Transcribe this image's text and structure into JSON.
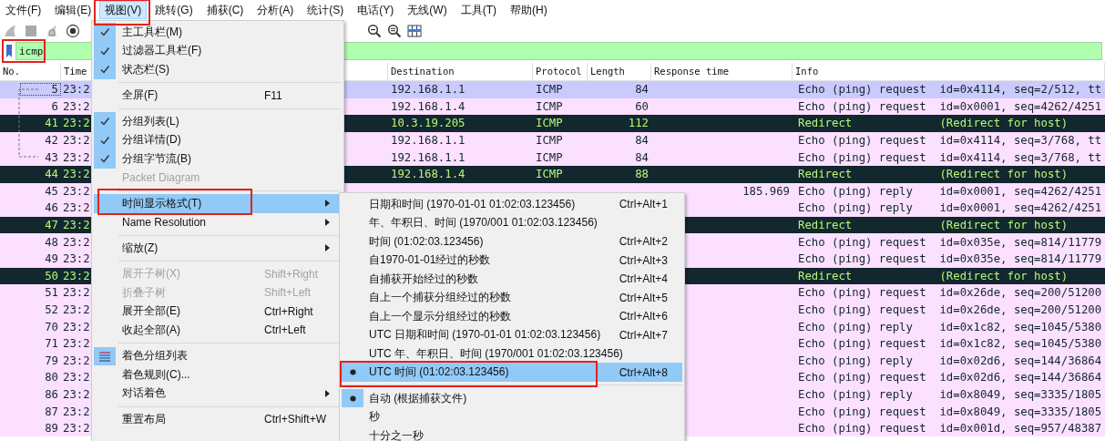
{
  "menubar": [
    {
      "label": "文件(F)",
      "selected": false,
      "annotated": false
    },
    {
      "label": "编辑(E)",
      "selected": false,
      "annotated": false
    },
    {
      "label": "视图(V)",
      "selected": true,
      "annotated": true
    },
    {
      "label": "跳转(G)",
      "selected": false,
      "annotated": false
    },
    {
      "label": "捕获(C)",
      "selected": false,
      "annotated": false
    },
    {
      "label": "分析(A)",
      "selected": false,
      "annotated": false
    },
    {
      "label": "统计(S)",
      "selected": false,
      "annotated": false
    },
    {
      "label": "电话(Y)",
      "selected": false,
      "annotated": false
    },
    {
      "label": "无线(W)",
      "selected": false,
      "annotated": false
    },
    {
      "label": "工具(T)",
      "selected": false,
      "annotated": false
    },
    {
      "label": "帮助(H)",
      "selected": false,
      "annotated": false
    }
  ],
  "filter": {
    "value": "icmp",
    "annotated": true
  },
  "table": {
    "columns": [
      {
        "label": "No."
      },
      {
        "label": "Time"
      },
      {
        "label": "Destination"
      },
      {
        "label": "Protocol"
      },
      {
        "label": "Length"
      },
      {
        "label": "Response time"
      },
      {
        "label": "Info"
      }
    ],
    "rows": [
      {
        "no": "5",
        "time": "23:2",
        "destination": "192.168.1.1",
        "protocol": "ICMP",
        "length": "84",
        "info": "Echo (ping) request  id=0x4114, seq=2/512, tt",
        "kind": "echo",
        "selected": true
      },
      {
        "no": "6",
        "time": "23:2",
        "destination": "192.168.1.4",
        "protocol": "ICMP",
        "length": "60",
        "info": "Echo (ping) request  id=0x0001, seq=4262/4251",
        "kind": "echo",
        "selected": false
      },
      {
        "no": "41",
        "time": "23:2",
        "destination": "10.3.19.205",
        "protocol": "ICMP",
        "length": "112",
        "info": "Redirect             (Redirect for host)",
        "kind": "error",
        "selected": false
      },
      {
        "no": "42",
        "time": "23:2",
        "destination": "192.168.1.1",
        "protocol": "ICMP",
        "length": "84",
        "info": "Echo (ping) request  id=0x4114, seq=3/768, tt",
        "kind": "echo",
        "selected": false
      },
      {
        "no": "43",
        "time": "23:2",
        "destination": "192.168.1.1",
        "protocol": "ICMP",
        "length": "84",
        "info": "Echo (ping) request  id=0x4114, seq=3/768, tt",
        "kind": "echo",
        "selected": false
      },
      {
        "no": "44",
        "time": "23:2",
        "destination": "192.168.1.4",
        "protocol": "ICMP",
        "length": "88",
        "info": "Redirect             (Redirect for host)",
        "kind": "error",
        "selected": false
      },
      {
        "no": "45",
        "time": "23:2",
        "response_time": "185.969",
        "info": "Echo (ping) reply    id=0x0001, seq=4262/4251",
        "kind": "echo",
        "selected": false
      },
      {
        "no": "46",
        "time": "23:2",
        "info": "Echo (ping) reply    id=0x0001, seq=4262/4251",
        "kind": "echo",
        "selected": false
      },
      {
        "no": "47",
        "time": "23:2",
        "info": "Redirect             (Redirect for host)",
        "kind": "error",
        "selected": false
      },
      {
        "no": "48",
        "time": "23:2",
        "info": "Echo (ping) request  id=0x035e, seq=814/11779",
        "kind": "echo",
        "selected": false
      },
      {
        "no": "49",
        "time": "23:2",
        "info": "Echo (ping) request  id=0x035e, seq=814/11779",
        "kind": "echo",
        "selected": false
      },
      {
        "no": "50",
        "time": "23:2",
        "info": "Redirect             (Redirect for host)",
        "kind": "error",
        "selected": false
      },
      {
        "no": "51",
        "time": "23:2",
        "info": "Echo (ping) request  id=0x26de, seq=200/51200",
        "kind": "echo",
        "selected": false
      },
      {
        "no": "52",
        "time": "23:2",
        "info": "Echo (ping) request  id=0x26de, seq=200/51200",
        "kind": "echo",
        "selected": false
      },
      {
        "no": "70",
        "time": "23:2",
        "info": "Echo (ping) reply    id=0x1c82, seq=1045/5380",
        "kind": "echo",
        "selected": false
      },
      {
        "no": "71",
        "time": "23:2",
        "info": "Echo (ping) request  id=0x1c82, seq=1045/5380",
        "kind": "echo",
        "selected": false
      },
      {
        "no": "79",
        "time": "23:2",
        "info": "Echo (ping) reply    id=0x02d6, seq=144/36864",
        "kind": "echo",
        "selected": false
      },
      {
        "no": "80",
        "time": "23:2",
        "info": "Echo (ping) request  id=0x02d6, seq=144/36864",
        "kind": "echo",
        "selected": false
      },
      {
        "no": "86",
        "time": "23:2",
        "info": "Echo (ping) reply    id=0x8049, seq=3335/1805",
        "kind": "echo",
        "selected": false
      },
      {
        "no": "87",
        "time": "23:2",
        "info": "Echo (ping) request  id=0x8049, seq=3335/1805",
        "kind": "echo",
        "selected": false
      },
      {
        "no": "89",
        "time": "23:2",
        "info": "Echo (ping) request  id=0x001d, seq=957/48387",
        "kind": "echo",
        "selected": false
      }
    ]
  },
  "view_menu": {
    "items": [
      {
        "kind": "item",
        "label": "主工具栏(M)",
        "checked": true,
        "disabled": false,
        "highlighted": false,
        "submenu": false,
        "annotated": false
      },
      {
        "kind": "item",
        "label": "过滤器工具栏(F)",
        "checked": true,
        "disabled": false,
        "highlighted": false,
        "submenu": false,
        "annotated": false
      },
      {
        "kind": "item",
        "label": "状态栏(S)",
        "checked": true,
        "disabled": false,
        "highlighted": false,
        "submenu": false,
        "annotated": false
      },
      {
        "kind": "separator"
      },
      {
        "kind": "item",
        "label": "全屏(F)",
        "shortcut": "F11",
        "checked": false,
        "disabled": false,
        "highlighted": false,
        "submenu": false,
        "annotated": false
      },
      {
        "kind": "separator"
      },
      {
        "kind": "item",
        "label": "分组列表(L)",
        "checked": true,
        "disabled": false,
        "highlighted": false,
        "submenu": false,
        "annotated": false
      },
      {
        "kind": "item",
        "label": "分组详情(D)",
        "checked": true,
        "disabled": false,
        "highlighted": false,
        "submenu": false,
        "annotated": false
      },
      {
        "kind": "item",
        "label": "分组字节流(B)",
        "checked": true,
        "disabled": false,
        "highlighted": false,
        "submenu": false,
        "annotated": false
      },
      {
        "kind": "item",
        "label": "Packet Diagram",
        "checked": false,
        "disabled": true,
        "highlighted": false,
        "submenu": false,
        "annotated": false
      },
      {
        "kind": "separator"
      },
      {
        "kind": "item",
        "label": "时间显示格式(T)",
        "checked": false,
        "disabled": false,
        "highlighted": true,
        "submenu": true,
        "annotated": true
      },
      {
        "kind": "item",
        "label": "Name Resolution",
        "checked": false,
        "disabled": false,
        "highlighted": false,
        "submenu": true,
        "annotated": false
      },
      {
        "kind": "separator"
      },
      {
        "kind": "item",
        "label": "缩放(Z)",
        "checked": false,
        "disabled": false,
        "highlighted": false,
        "submenu": true,
        "annotated": false
      },
      {
        "kind": "separator"
      },
      {
        "kind": "item",
        "label": "展开子树(X)",
        "shortcut": "Shift+Right",
        "checked": false,
        "disabled": true,
        "highlighted": false,
        "submenu": false,
        "annotated": false
      },
      {
        "kind": "item",
        "label": "折叠子树",
        "shortcut": "Shift+Left",
        "checked": false,
        "disabled": true,
        "highlighted": false,
        "submenu": false,
        "annotated": false
      },
      {
        "kind": "item",
        "label": "展开全部(E)",
        "shortcut": "Ctrl+Right",
        "checked": false,
        "disabled": false,
        "highlighted": false,
        "submenu": false,
        "annotated": false
      },
      {
        "kind": "item",
        "label": "收起全部(A)",
        "shortcut": "Ctrl+Left",
        "checked": false,
        "disabled": false,
        "highlighted": false,
        "submenu": false,
        "annotated": false
      },
      {
        "kind": "separator"
      },
      {
        "kind": "icon_toggle",
        "label": "着色分组列表",
        "checked": true,
        "disabled": false,
        "highlighted": false,
        "submenu": false,
        "annotated": false
      },
      {
        "kind": "item",
        "label": "着色规则(C)...",
        "checked": false,
        "disabled": false,
        "highlighted": false,
        "submenu": false,
        "annotated": false
      },
      {
        "kind": "item",
        "label": "对话着色",
        "checked": false,
        "disabled": false,
        "highlighted": false,
        "submenu": true,
        "annotated": false
      },
      {
        "kind": "separator"
      },
      {
        "kind": "item",
        "label": "重置布局",
        "shortcut": "Ctrl+Shift+W",
        "checked": false,
        "disabled": false,
        "highlighted": false,
        "submenu": false,
        "annotated": false
      }
    ]
  },
  "time_format_menu": {
    "items": [
      {
        "kind": "radio",
        "label": "日期和时间 (1970-01-01 01:02:03.123456)",
        "shortcut": "Ctrl+Alt+1",
        "selected": false,
        "highlighted": false,
        "annotated": false
      },
      {
        "kind": "radio",
        "label": "年、年积日、时间 (1970/001 01:02:03.123456)",
        "selected": false,
        "highlighted": false,
        "annotated": false
      },
      {
        "kind": "radio",
        "label": "时间 (01:02:03.123456)",
        "shortcut": "Ctrl+Alt+2",
        "selected": false,
        "highlighted": false,
        "annotated": false
      },
      {
        "kind": "radio",
        "label": "自1970-01-01经过的秒数",
        "shortcut": "Ctrl+Alt+3",
        "selected": false,
        "highlighted": false,
        "annotated": false
      },
      {
        "kind": "radio",
        "label": "自捕获开始经过的秒数",
        "shortcut": "Ctrl+Alt+4",
        "selected": false,
        "highlighted": false,
        "annotated": false
      },
      {
        "kind": "radio",
        "label": "自上一个捕获分组经过的秒数",
        "shortcut": "Ctrl+Alt+5",
        "selected": false,
        "highlighted": false,
        "annotated": false
      },
      {
        "kind": "radio",
        "label": "自上一个显示分组经过的秒数",
        "shortcut": "Ctrl+Alt+6",
        "selected": false,
        "highlighted": false,
        "annotated": false
      },
      {
        "kind": "radio",
        "label": "UTC 日期和时间 (1970-01-01 01:02:03.123456)",
        "shortcut": "Ctrl+Alt+7",
        "selected": false,
        "highlighted": false,
        "annotated": false
      },
      {
        "kind": "radio",
        "label": "UTC 年、年积日、时间 (1970/001 01:02:03.123456)",
        "selected": false,
        "highlighted": false,
        "annotated": false
      },
      {
        "kind": "radio",
        "label": "UTC 时间 (01:02:03.123456)",
        "shortcut": "Ctrl+Alt+8",
        "selected": true,
        "highlighted": true,
        "annotated": true
      },
      {
        "kind": "separator"
      },
      {
        "kind": "radio",
        "label": "自动 (根据捕获文件)",
        "selected": true,
        "highlighted": false,
        "annotated": false
      },
      {
        "kind": "radio",
        "label": "秒",
        "selected": false,
        "highlighted": false,
        "annotated": false
      },
      {
        "kind": "radio",
        "label": "十分之一秒",
        "selected": false,
        "highlighted": false,
        "annotated": false
      }
    ]
  }
}
